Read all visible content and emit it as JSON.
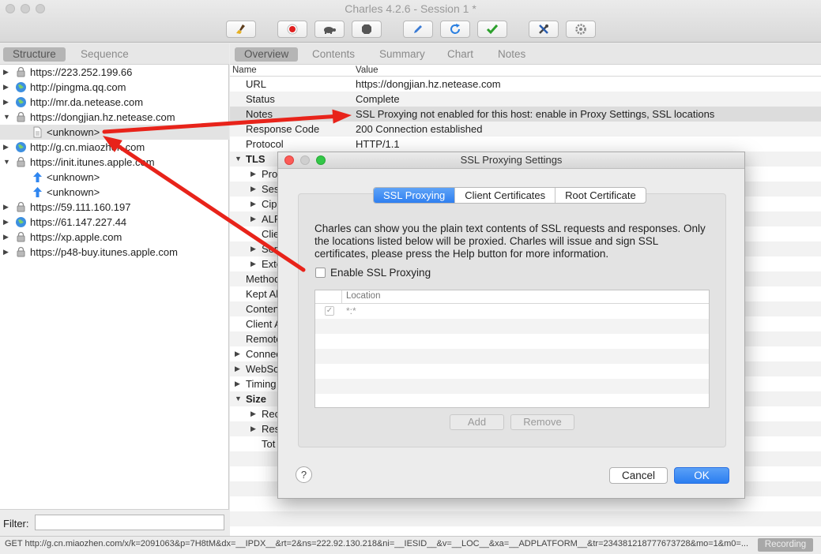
{
  "window": {
    "title": "Charles 4.2.6 - Session 1 *"
  },
  "toolbar": {
    "buttons": [
      {
        "name": "broom-icon",
        "color": "#e0a020"
      },
      {
        "name": "record-icon",
        "color": "#e02020"
      },
      {
        "name": "turtle-icon",
        "color": "#555555"
      },
      {
        "name": "stop-hexagon-icon",
        "color": "#555555"
      },
      {
        "name": "pen-icon",
        "color": "#3a7bd5"
      },
      {
        "name": "refresh-icon",
        "color": "#2a7fe0"
      },
      {
        "name": "checkmark-icon",
        "color": "#2ca02c"
      },
      {
        "name": "tools-icon",
        "color": "#444444"
      },
      {
        "name": "gear-icon",
        "color": "#888888"
      }
    ]
  },
  "left": {
    "tabs": [
      {
        "label": "Structure",
        "active": true
      },
      {
        "label": "Sequence",
        "active": false
      }
    ],
    "tree": [
      {
        "label": "https://223.252.199.66",
        "icon": "lock",
        "expand": "closed",
        "level": 0
      },
      {
        "label": "http://pingma.qq.com",
        "icon": "globe",
        "expand": "closed",
        "level": 0
      },
      {
        "label": "http://mr.da.netease.com",
        "icon": "globe",
        "expand": "closed",
        "level": 0
      },
      {
        "label": "https://dongjian.hz.netease.com",
        "icon": "lock",
        "expand": "open",
        "level": 0
      },
      {
        "label": "<unknown>",
        "icon": "doc",
        "expand": "none",
        "level": 1,
        "selected": true
      },
      {
        "label": "http://g.cn.miaozhen.com",
        "icon": "globe",
        "expand": "closed",
        "level": 0
      },
      {
        "label": "https://init.itunes.apple.com",
        "icon": "lock",
        "expand": "open",
        "level": 0
      },
      {
        "label": "<unknown>",
        "icon": "up",
        "expand": "none",
        "level": 1
      },
      {
        "label": "<unknown>",
        "icon": "up",
        "expand": "none",
        "level": 1
      },
      {
        "label": "https://59.111.160.197",
        "icon": "lock",
        "expand": "closed",
        "level": 0
      },
      {
        "label": "https://61.147.227.44",
        "icon": "globe",
        "expand": "closed",
        "level": 0
      },
      {
        "label": "https://xp.apple.com",
        "icon": "lock",
        "expand": "closed",
        "level": 0
      },
      {
        "label": "https://p48-buy.itunes.apple.com",
        "icon": "lock",
        "expand": "closed",
        "level": 0
      }
    ],
    "filter_label": "Filter:"
  },
  "right": {
    "tabs": [
      {
        "label": "Overview",
        "active": true
      },
      {
        "label": "Contents",
        "active": false
      },
      {
        "label": "Summary",
        "active": false
      },
      {
        "label": "Chart",
        "active": false
      },
      {
        "label": "Notes",
        "active": false
      }
    ],
    "header": {
      "name": "Name",
      "value": "Value"
    },
    "rows": [
      {
        "key": "URL",
        "value": "https://dongjian.hz.netease.com",
        "indent": 0
      },
      {
        "key": "Status",
        "value": "Complete",
        "indent": 0
      },
      {
        "key": "Notes",
        "value": "SSL Proxying not enabled for this host: enable in Proxy Settings, SSL locations",
        "indent": 0,
        "selected": true
      },
      {
        "key": "Response Code",
        "value": "200 Connection established",
        "indent": 0
      },
      {
        "key": "Protocol",
        "value": "HTTP/1.1",
        "indent": 0
      },
      {
        "key": "TLS",
        "value": "",
        "indent": 0,
        "group": "open",
        "bold": true
      },
      {
        "key": "Pro",
        "value": "",
        "indent": 1,
        "group": "closed"
      },
      {
        "key": "Ses",
        "value": "",
        "indent": 1,
        "group": "closed"
      },
      {
        "key": "Cip",
        "value": "",
        "indent": 1,
        "group": "closed"
      },
      {
        "key": "ALP",
        "value": "",
        "indent": 1,
        "group": "closed"
      },
      {
        "key": "Clie",
        "value": "",
        "indent": 1
      },
      {
        "key": "Ser",
        "value": "",
        "indent": 1,
        "group": "closed"
      },
      {
        "key": "Exte",
        "value": "",
        "indent": 1,
        "group": "closed"
      },
      {
        "key": "Method",
        "value": "",
        "indent": 0
      },
      {
        "key": "Kept Al",
        "value": "",
        "indent": 0
      },
      {
        "key": "Conten",
        "value": "",
        "indent": 0
      },
      {
        "key": "Client A",
        "value": "",
        "indent": 0
      },
      {
        "key": "Remote",
        "value": "",
        "indent": 0
      },
      {
        "key": "Connec",
        "value": "",
        "indent": 0,
        "group": "closed"
      },
      {
        "key": "WebSo",
        "value": "",
        "indent": 0,
        "group": "closed"
      },
      {
        "key": "Timing",
        "value": "",
        "indent": 0,
        "group": "closed"
      },
      {
        "key": "Size",
        "value": "",
        "indent": 0,
        "group": "open",
        "bold": true
      },
      {
        "key": "Rec",
        "value": "",
        "indent": 1,
        "group": "closed"
      },
      {
        "key": "Res",
        "value": "",
        "indent": 1,
        "group": "closed"
      },
      {
        "key": "Tot",
        "value": "",
        "indent": 1
      }
    ]
  },
  "status": {
    "text": "GET http://g.cn.miaozhen.com/x/k=2091063&p=7H8tM&dx=__IPDX__&rt=2&ns=222.92.130.218&ni=__IESID__&v=__LOC__&xa=__ADPLATFORM__&tr=234381218777673728&mo=1&m0=...",
    "recording_label": "Recording"
  },
  "dialog": {
    "title": "SSL Proxying Settings",
    "tabs": [
      {
        "label": "SSL Proxying",
        "active": true
      },
      {
        "label": "Client Certificates",
        "active": false
      },
      {
        "label": "Root Certificate",
        "active": false
      }
    ],
    "description": "Charles can show you the plain text contents of SSL requests and responses. Only the locations listed below will be proxied. Charles will issue and sign SSL certificates, please press the Help button for more information.",
    "enable_label": "Enable SSL Proxying",
    "enable_checked": false,
    "table": {
      "column": "Location",
      "rows": [
        {
          "checked": true,
          "location": "*:*"
        }
      ]
    },
    "add_label": "Add",
    "remove_label": "Remove",
    "help_label": "?",
    "cancel_label": "Cancel",
    "ok_label": "OK",
    "accent": "#2f7ff0"
  },
  "annotation": {
    "arrow_color": "#e8231a"
  }
}
